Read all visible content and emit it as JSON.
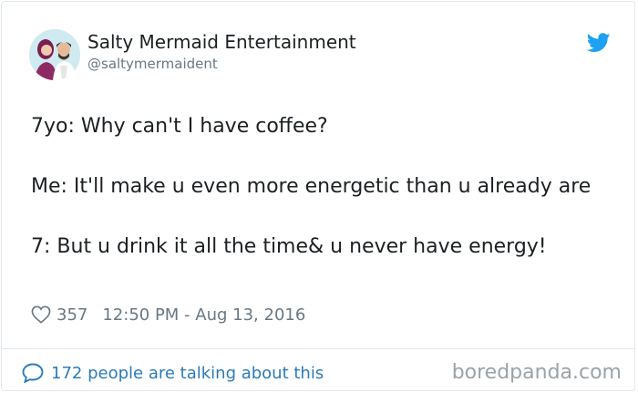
{
  "tweet": {
    "author_name": "Salty Mermaid Entertainment",
    "author_handle": "@saltymermaident",
    "lines": [
      "7yo: Why can't I have coffee?",
      "Me: It'll make u even more energetic than u already are",
      "7: But u drink it all the time& u never have energy!"
    ],
    "likes": "357",
    "timestamp": "12:50 PM - Aug 13, 2016",
    "conversation_link": "172 people are talking about this"
  },
  "watermark": "boredpanda.com",
  "colors": {
    "text": "#1c2022",
    "muted": "#697882",
    "link": "#2b7bb9",
    "twitter_blue": "#1da1f2",
    "border": "#e1e8ed"
  },
  "icons": {
    "bird": "twitter-bird-icon",
    "heart": "heart-icon",
    "bubble": "speech-bubble-icon"
  }
}
